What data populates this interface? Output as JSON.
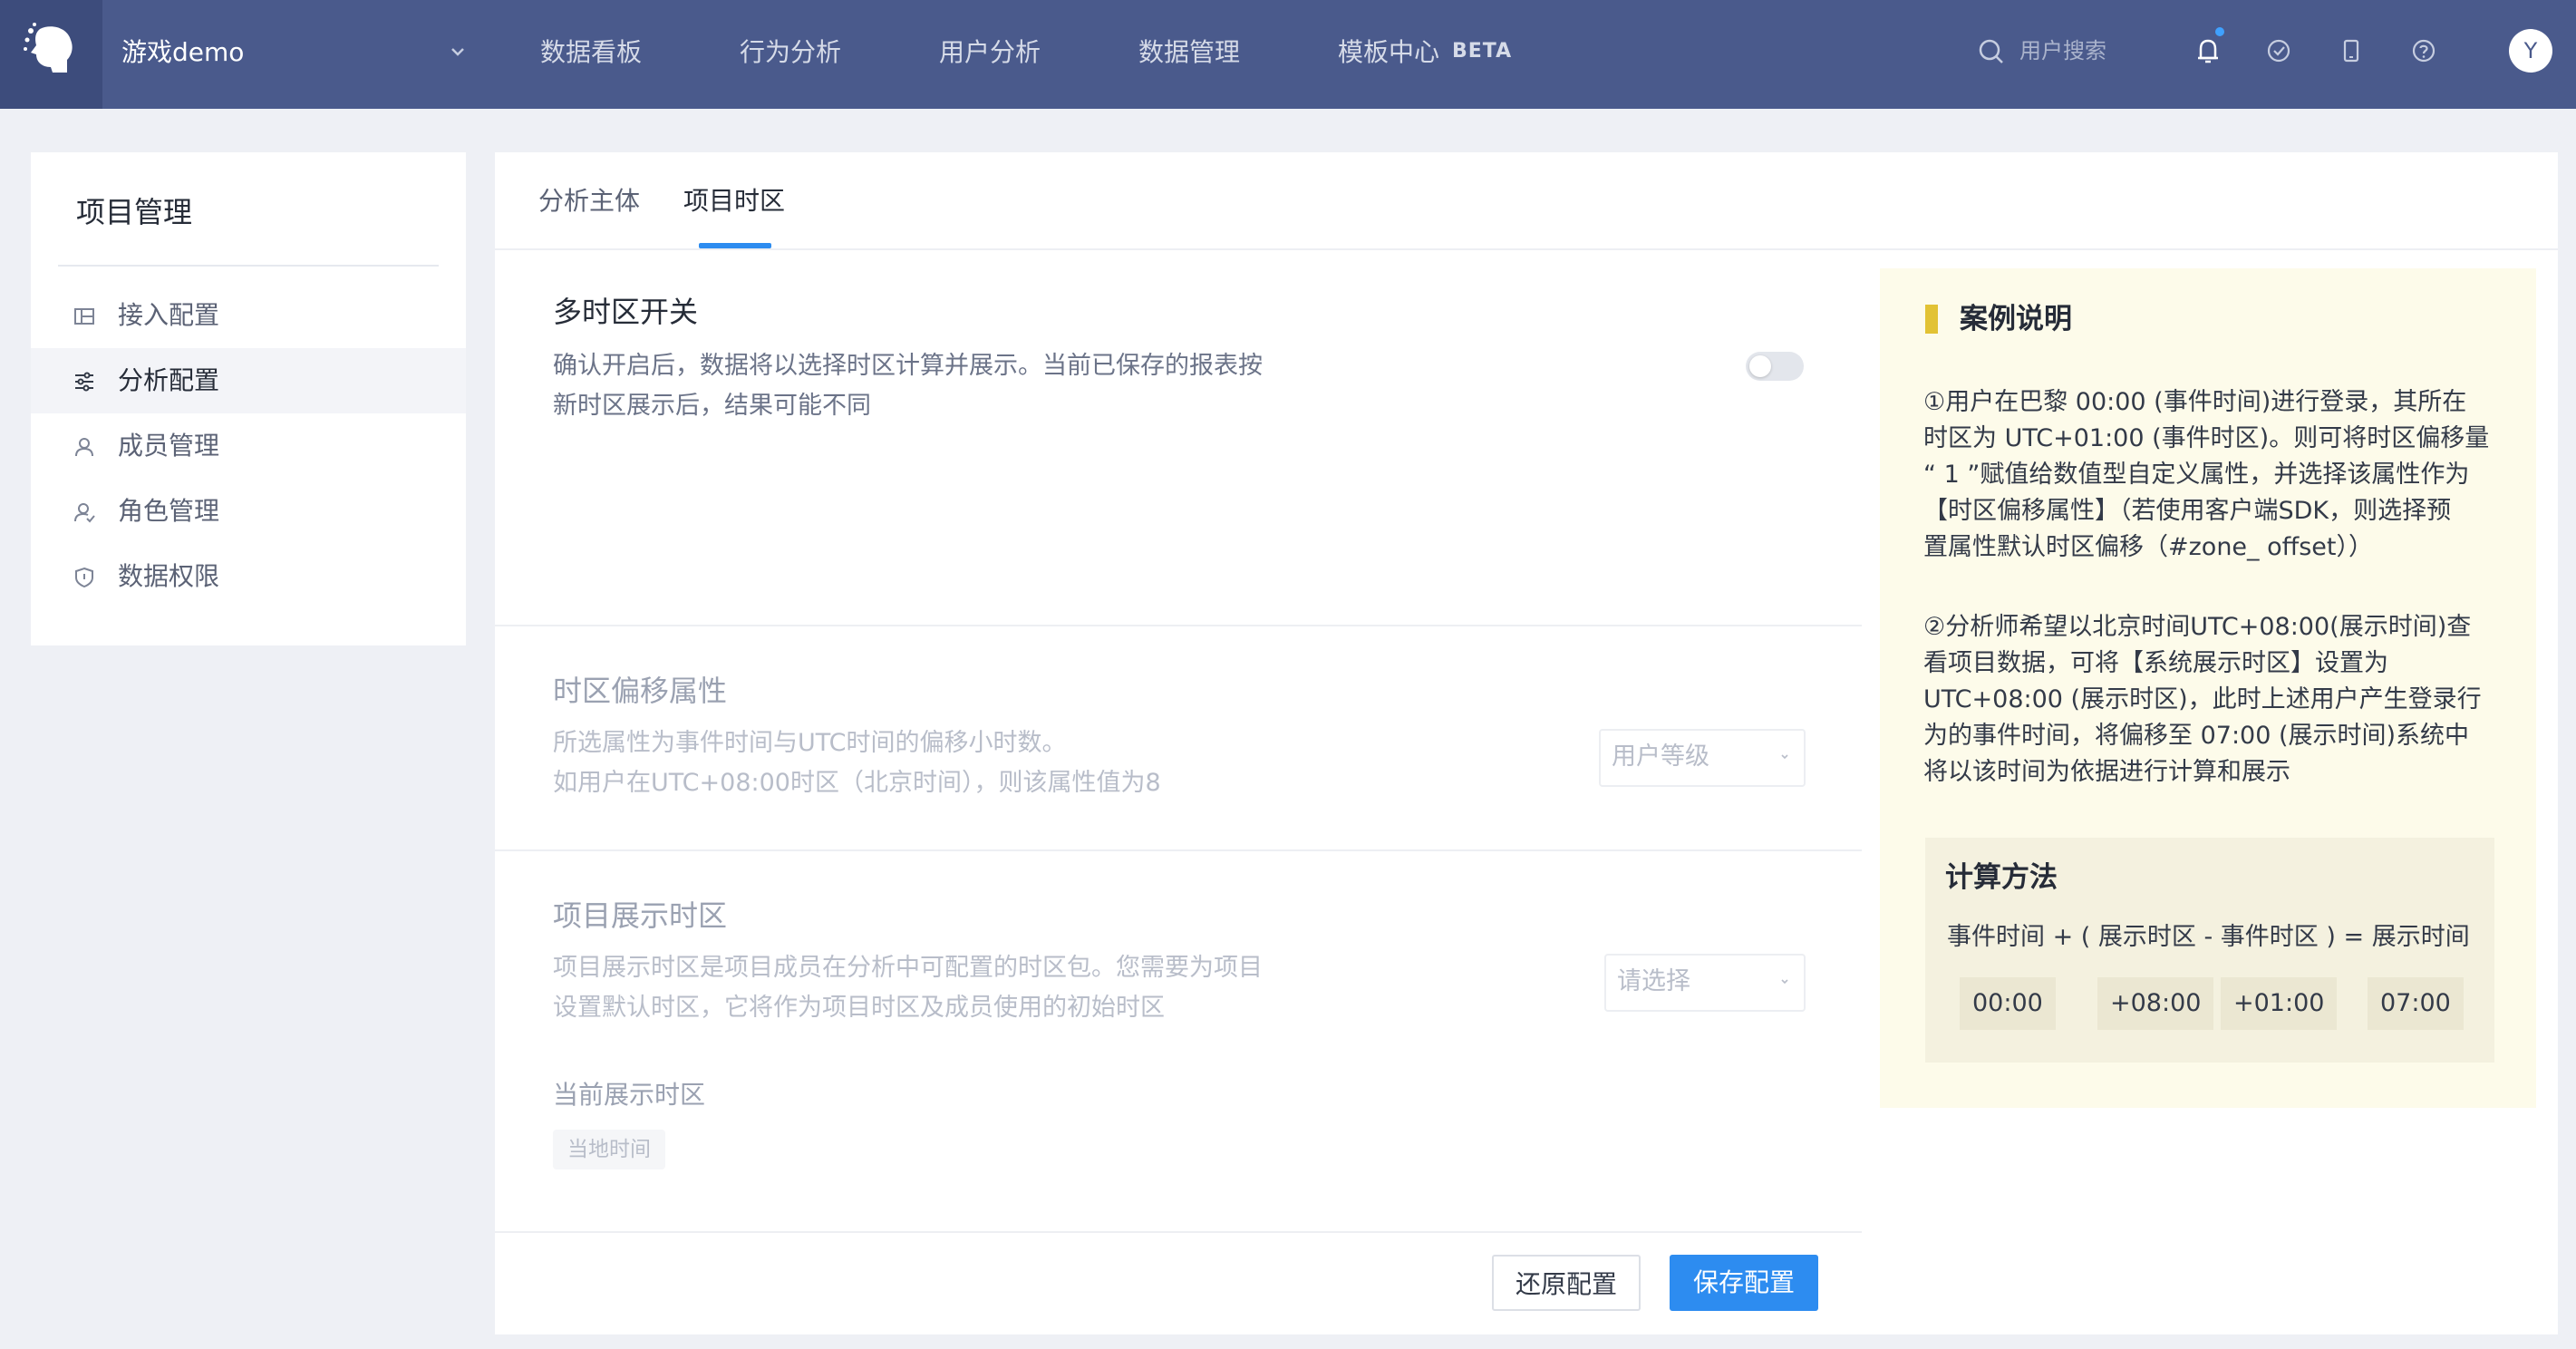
{
  "app": {
    "project_name": "游戏demo",
    "nav": [
      "数据看板",
      "行为分析",
      "用户分析",
      "数据管理",
      "模板中心"
    ],
    "beta_badge": "BETA",
    "search_placeholder": "用户搜索",
    "avatar_initial": "Y",
    "icons": [
      "logo-icon",
      "chevron-down-icon",
      "search-icon",
      "bell-icon",
      "check-circle-icon",
      "tablet-icon",
      "help-icon"
    ]
  },
  "sidebar": {
    "title": "项目管理",
    "items": [
      {
        "label": "接入配置",
        "icon": "layout-icon"
      },
      {
        "label": "分析配置",
        "icon": "sliders-icon",
        "active": true
      },
      {
        "label": "成员管理",
        "icon": "user-icon"
      },
      {
        "label": "角色管理",
        "icon": "user-role-icon"
      },
      {
        "label": "数据权限",
        "icon": "shield-icon"
      }
    ]
  },
  "tabs": [
    {
      "label": "分析主体",
      "active": false
    },
    {
      "label": "项目时区",
      "active": true
    }
  ],
  "multi_tz": {
    "title": "多时区开关",
    "desc_line1": "确认开启后，数据将以选择时区计算并展示。当前已保存的报表按",
    "desc_line2": "新时区展示后，结果可能不同",
    "enabled": false
  },
  "offset_attr": {
    "title": "时区偏移属性",
    "desc_line1": "所选属性为事件时间与UTC时间的偏移小时数。",
    "desc_line2": "如用户在UTC+08:00时区（北京时间），则该属性值为8",
    "select_value": "用户等级"
  },
  "display_tz": {
    "title": "项目展示时区",
    "desc_line1": "项目展示时区是项目成员在分析中可配置的时区包。您需要为项目",
    "desc_line2": "设置默认时区，它将作为项目时区及成员使用的初始时区",
    "select_placeholder": "请选择",
    "current_label": "当前展示时区",
    "current_tag": "当地时间"
  },
  "buttons": {
    "reset": "还原配置",
    "save": "保存配置"
  },
  "case": {
    "title": "案例说明",
    "p1": [
      "①用户在巴黎 00:00 (事件时间)进行登录，其所在",
      "时区为 UTC+01:00 (事件时区)。则可将时区偏移量",
      "“ 1 ”赋值给数值型自定义属性，并选择该属性作为",
      "【时区偏移属性】（若使用客户端SDK，则选择预",
      "置属性默认时区偏移（#zone_ offset））"
    ],
    "p2": [
      "②分析师希望以北京时间UTC+08:00(展示时间)查",
      "看项目数据，可将【系统展示时区】设置为",
      " UTC+08:00 (展示时区)，此时上述用户产生登录行",
      "为的事件时间，将偏移至 07:00 (展示时间)系统中",
      "将以该时间为依据进行计算和展示"
    ],
    "calc": {
      "title": "计算方法",
      "formula": "事件时间 + ( 展示时区 - 事件时区 ) = 展示时间",
      "values": [
        "00:00",
        "+08:00",
        "+01:00",
        "07:00"
      ]
    }
  },
  "colors": {
    "nav_bg": "#4a5a8c",
    "accent": "#2d8cf0",
    "case_bg": "#fdfbea",
    "case_marker": "#e2c234"
  }
}
